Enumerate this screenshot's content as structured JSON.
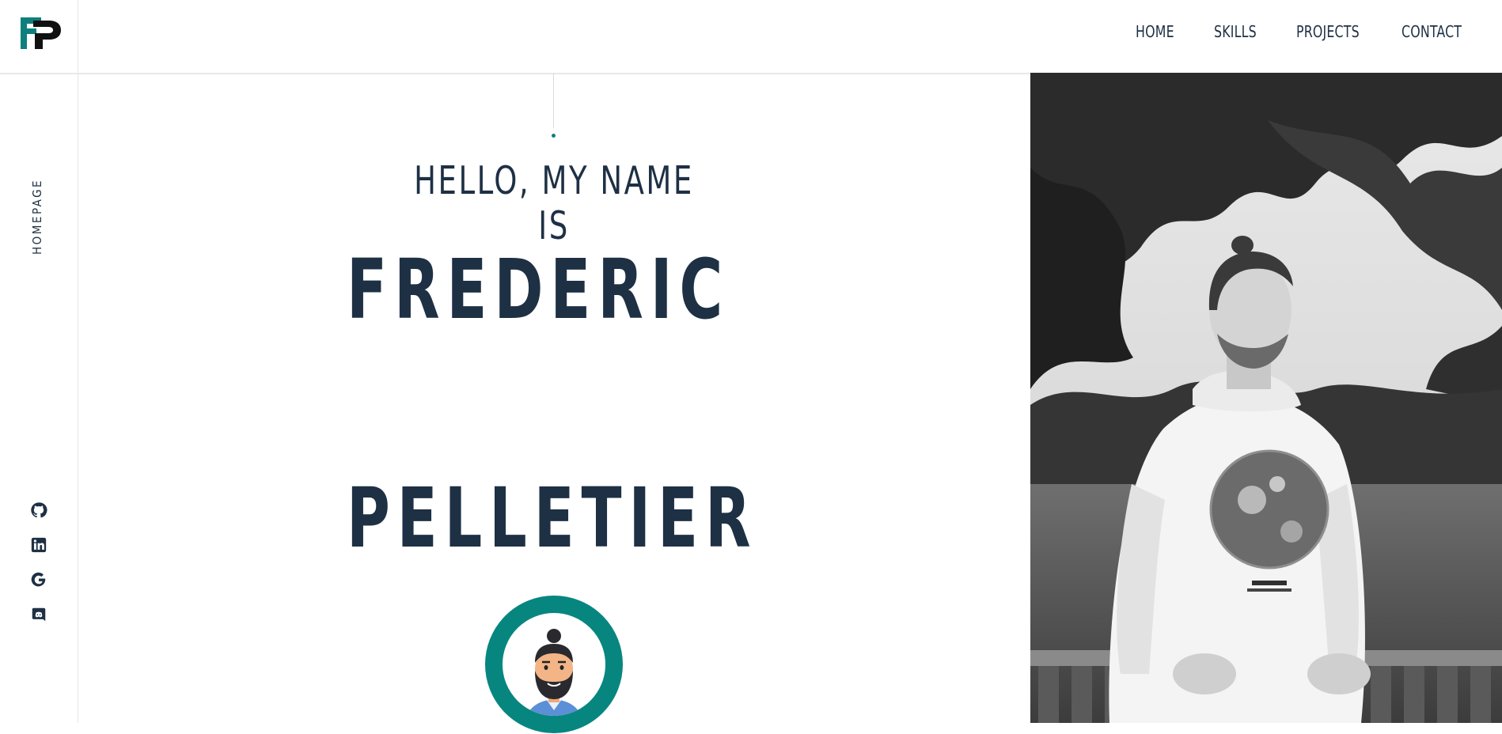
{
  "header": {
    "logo_icon": "fp-monogram-logo",
    "nav": [
      "HOME",
      "SKILLS",
      "PROJECTS",
      "CONTACT"
    ]
  },
  "sidebar": {
    "label": "HOMEPAGE",
    "socials": [
      "github-icon",
      "linkedin-icon",
      "google-icon",
      "discord-icon"
    ]
  },
  "hero": {
    "greeting": "HELLO, MY NAME IS",
    "first_name": "FREDERIC",
    "last_name": "PELLETIER",
    "avatar_icon": "bearded-man-avatar"
  },
  "colors": {
    "text": "#1e3044",
    "accent": "#0e7f7c"
  }
}
